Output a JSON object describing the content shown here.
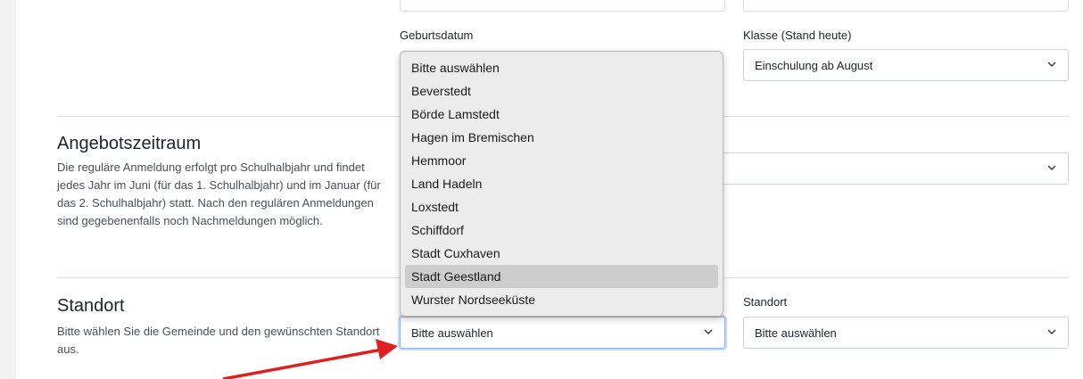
{
  "top_section": {
    "geburtsdatum_label": "Geburtsdatum",
    "klasse_label": "Klasse (Stand heute)",
    "klasse_value": "Einschulung ab August"
  },
  "angebot": {
    "title": "Angebotszeitraum",
    "description": "Die reguläre Anmeldung erfolgt pro Schulhalbjahr und findet jedes Jahr im Juni (für das 1. Schulhalbjahr) und im Januar (für das 2. Schulhalbjahr) statt. Nach den regulären Anmeldungen sind gegebenenfalls noch Nachmeldungen möglich.",
    "select_value": ""
  },
  "standort": {
    "title": "Standort",
    "description": "Bitte wählen Sie die Gemeinde und den gewünschten Standort aus.",
    "gemeinde_value": "Bitte auswählen",
    "standort_label": "Standort",
    "standort_value": "Bitte auswählen"
  },
  "dropdown": {
    "options": [
      "Bitte auswählen",
      "Beverstedt",
      "Börde Lamstedt",
      "Hagen im Bremischen",
      "Hemmoor",
      "Land Hadeln",
      "Loxstedt",
      "Schiffdorf",
      "Stadt Cuxhaven",
      "Stadt Geestland",
      "Wurster Nordseeküste"
    ],
    "highlighted": "Stadt Geestland"
  },
  "colors": {
    "arrow": "#e02020",
    "focus_border": "#8fb1e8",
    "highlight": "#cdcdcd"
  },
  "icons": [
    "chevron-down-icon",
    "annotation-arrow"
  ]
}
